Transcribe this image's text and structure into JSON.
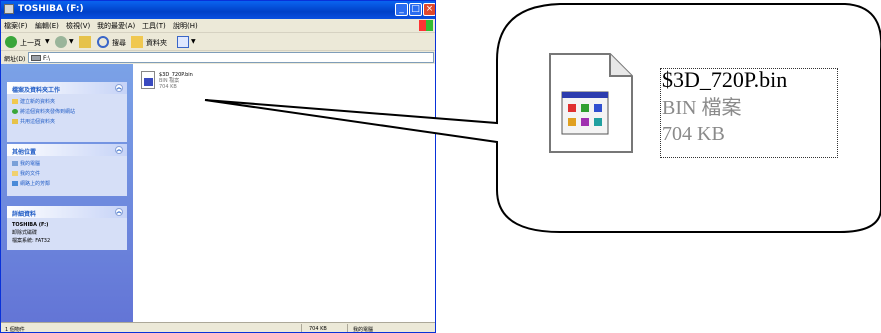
{
  "window": {
    "title": "TOSHIBA (F:)",
    "controls": {
      "minimize": "_",
      "maximize": "□",
      "close": "×"
    }
  },
  "menu": {
    "items": [
      "檔案(F)",
      "編輯(E)",
      "檢視(V)",
      "我的最愛(A)",
      "工具(T)",
      "說明(H)"
    ]
  },
  "toolbar": {
    "back_label": "上一頁",
    "search_label": "搜尋",
    "folders_label": "資料夾"
  },
  "address": {
    "label": "網址(D)",
    "value": "F:\\"
  },
  "task_pane": {
    "file_tasks": {
      "title": "檔案及資料夾工作",
      "items": [
        "建立新的資料夾",
        "將這個資料夾發佈到網站",
        "共用這個資料夾"
      ]
    },
    "other_places": {
      "title": "其他位置",
      "items": [
        "我的電腦",
        "我的文件",
        "網路上的芳鄰"
      ]
    },
    "details": {
      "title": "詳細資料",
      "name": "TOSHIBA (F:)",
      "type": "卸除式磁碟",
      "filesystem": "檔案系統: FAT32"
    }
  },
  "file": {
    "name": "$3D_720P.bin",
    "type": "BIN 檔案",
    "size": "704 KB"
  },
  "status": {
    "count": "1 個物件",
    "size": "704 KB",
    "location": "我的電腦"
  },
  "colors": {
    "title_bar": "#0a5ae8",
    "task_pane": "#6f8fe0",
    "link": "#215dc6"
  }
}
